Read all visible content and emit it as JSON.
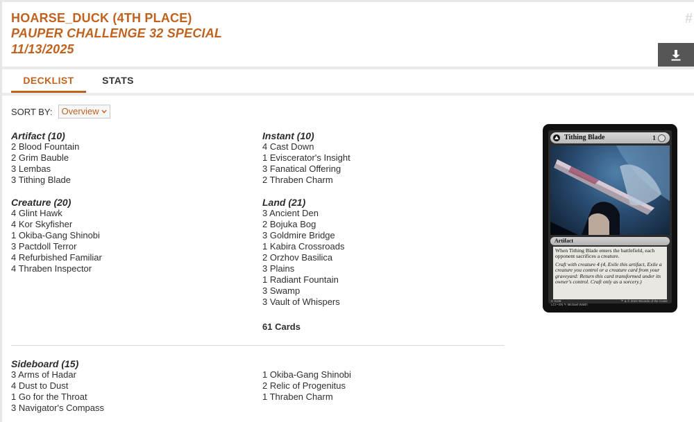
{
  "header": {
    "title": "HOARSE_DUCK (4TH PLACE)",
    "event": "PAUPER CHALLENGE 32 SPECIAL",
    "date": "11/13/2025",
    "hash_symbol": "#"
  },
  "download_icon": "download-icon",
  "tabs": [
    {
      "label": "DECKLIST",
      "active": true
    },
    {
      "label": "STATS",
      "active": false
    }
  ],
  "sort": {
    "label": "SORT BY:",
    "selected": "Overview"
  },
  "maindeck": {
    "left": [
      {
        "header": "Artifact (10)",
        "cards": [
          "2 Blood Fountain",
          "2 Grim Bauble",
          "3 Lembas",
          "3 Tithing Blade"
        ]
      },
      {
        "header": "Creature (20)",
        "cards": [
          "4 Glint Hawk",
          "4 Kor Skyfisher",
          "1 Okiba-Gang Shinobi",
          "3 Pactdoll Terror",
          "4 Refurbished Familiar",
          "4 Thraben Inspector"
        ]
      }
    ],
    "right": [
      {
        "header": "Instant (10)",
        "cards": [
          "4 Cast Down",
          "1 Eviscerator's Insight",
          "3 Fanatical Offering",
          "2 Thraben Charm"
        ]
      },
      {
        "header": "Land (21)",
        "cards": [
          "3 Ancient Den",
          "2 Bojuka Bog",
          "3 Goldmire Bridge",
          "1 Kabira Crossroads",
          "2 Orzhov Basilica",
          "3 Plains",
          "1 Radiant Fountain",
          "3 Swamp",
          "3 Vault of Whispers"
        ]
      }
    ],
    "total": "61 Cards"
  },
  "sideboard": {
    "header": "Sideboard (15)",
    "left": [
      "3 Arms of Hadar",
      "4 Dust to Dust",
      "1 Go for the Throat",
      "3 Navigator's Compass"
    ],
    "right": [
      "1 Okiba-Gang Shinobi",
      "2 Relic of Progenitus",
      "1 Thraben Charm"
    ]
  },
  "card_preview": {
    "name": "Tithing Blade",
    "cost": "1",
    "type": "Artifact",
    "rules_1": "When Tithing Blade enters the battlefield, each opponent sacrifices a creature.",
    "rules_2": "Craft with creature 4 (4, Exile this artifact, Exile a creature you control or a creature card from your graveyard: Return this card transformed under its owner's control. Craft only as a sorcery.)",
    "collector": "C 0128",
    "set_line": "LCI • EN ✎ Michael Walsh",
    "copyright": "™ & © 2023 Wizards of the Coast"
  },
  "colors": {
    "accent": "#c0621e",
    "download_bg": "#565656"
  }
}
